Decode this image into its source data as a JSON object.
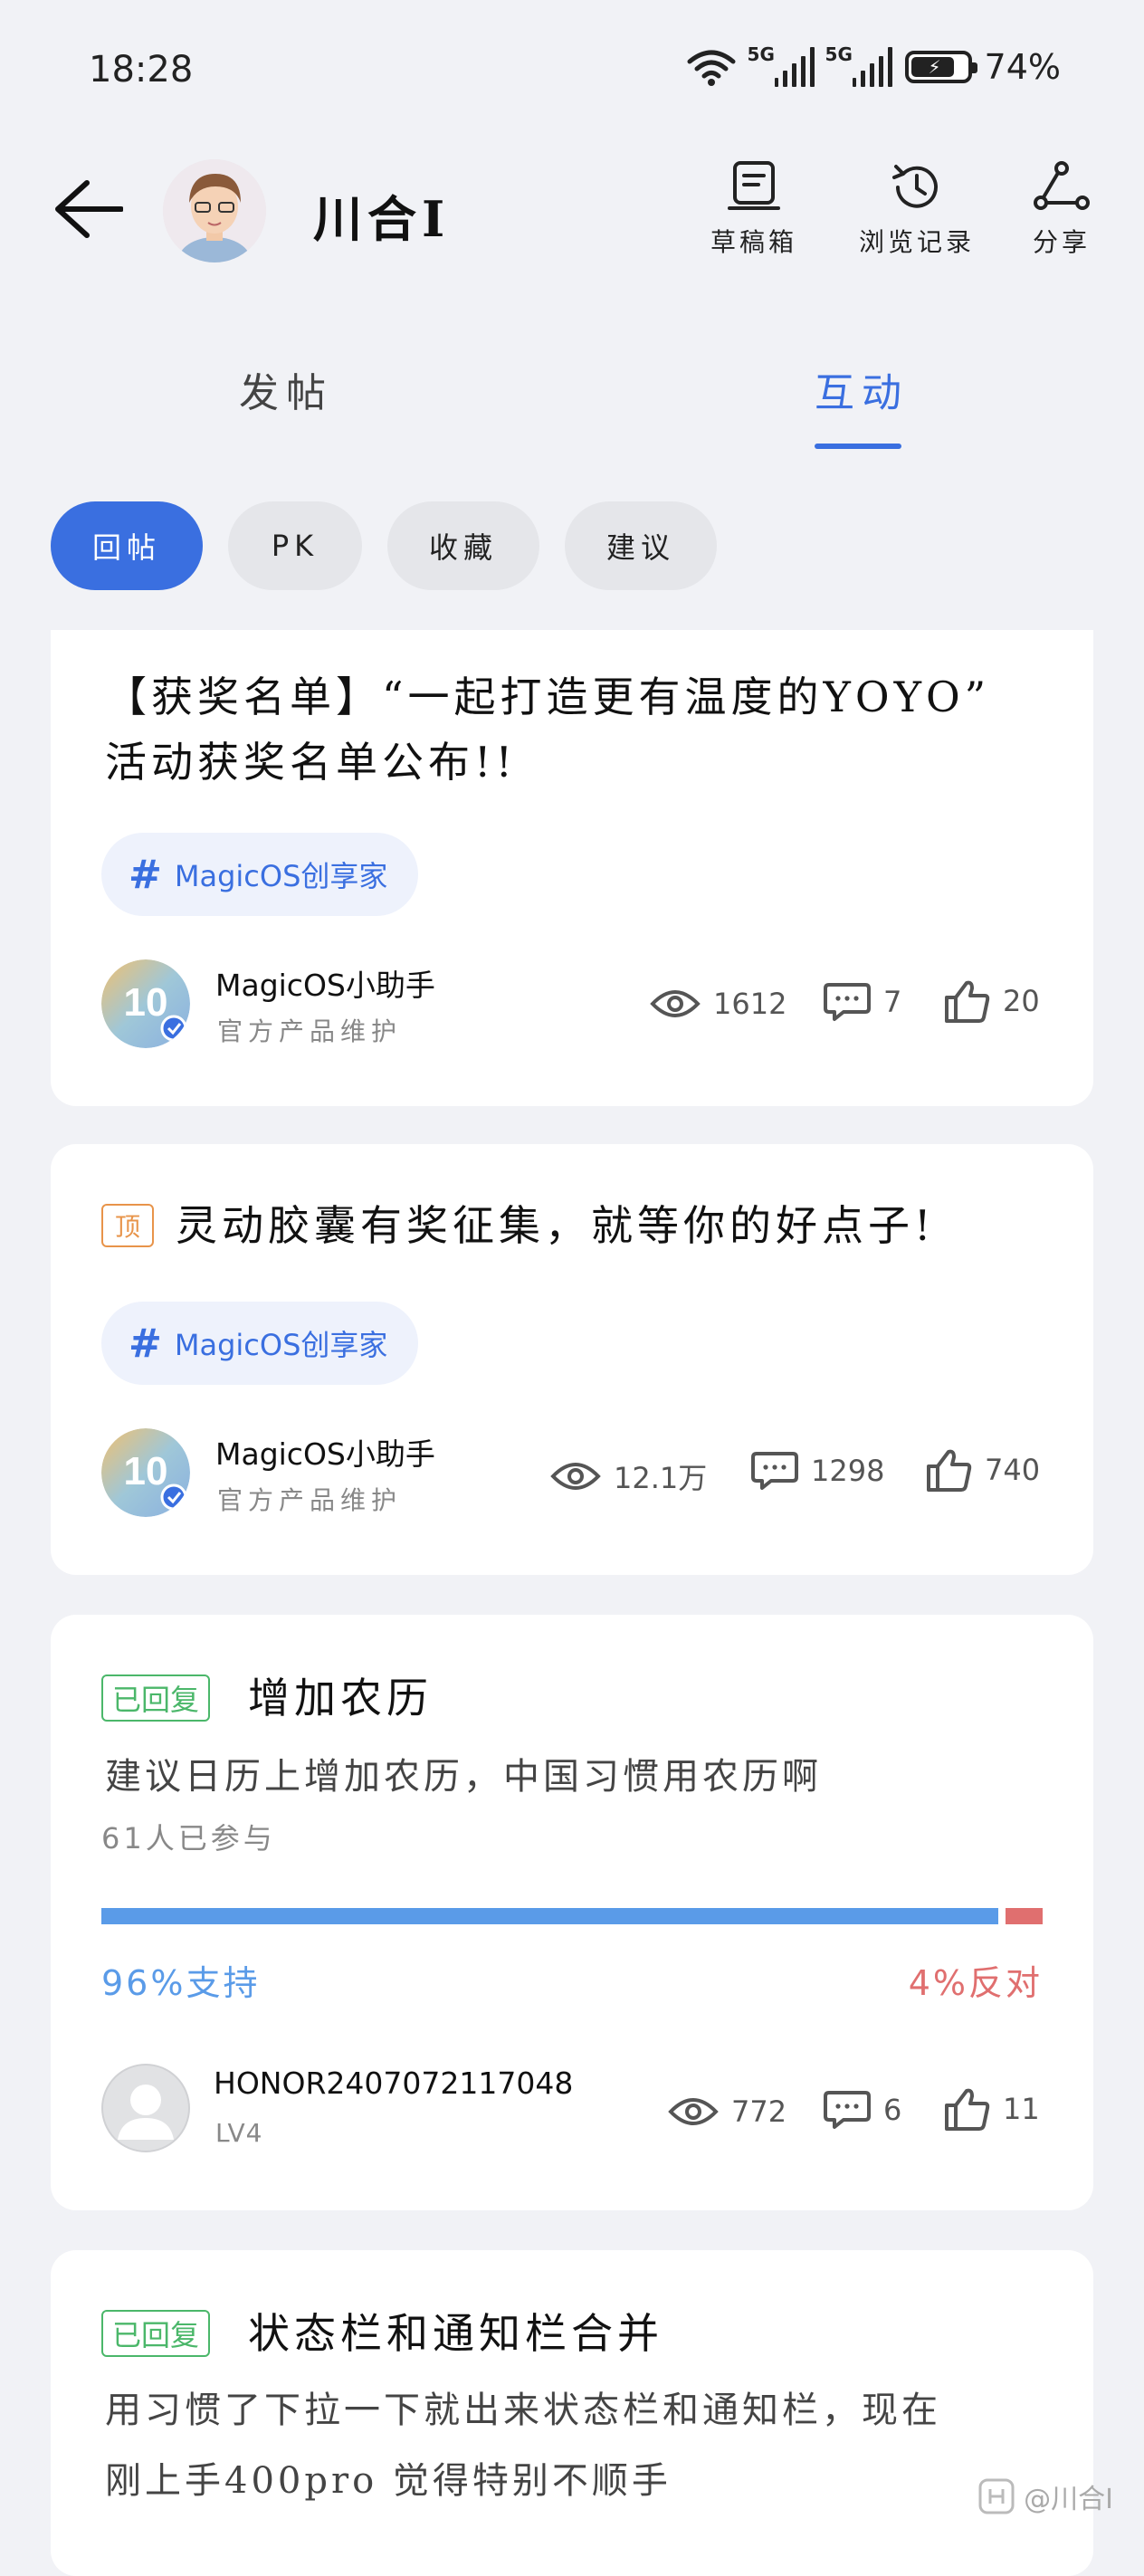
{
  "status_bar": {
    "time": "18:28",
    "network_1": "5G",
    "network_2": "5G",
    "battery": "74%"
  },
  "header": {
    "username": "川合I",
    "actions": [
      {
        "label": "草稿箱",
        "icon": "drafts-icon"
      },
      {
        "label": "浏览记录",
        "icon": "history-icon"
      },
      {
        "label": "分享",
        "icon": "share-icon"
      }
    ]
  },
  "tabs": [
    {
      "label": "发帖",
      "active": false
    },
    {
      "label": "互动",
      "active": true
    }
  ],
  "filters": [
    {
      "label": "回帖",
      "active": true
    },
    {
      "label": "PK",
      "active": false
    },
    {
      "label": "收藏",
      "active": false
    },
    {
      "label": "建议",
      "active": false
    }
  ],
  "posts": [
    {
      "title_line1": "【获奖名单】“一起打造更有温度的YOYO”",
      "title_line2": "活动获奖名单公布!!",
      "topic": "MagicOS创享家",
      "author": "MagicOS小助手",
      "author_sub": "官方产品维护",
      "author_avatar_text": "10",
      "views": "1612",
      "comments": "7",
      "likes": "20"
    },
    {
      "badge": "顶",
      "title": "灵动胶囊有奖征集，就等你的好点子!",
      "topic": "MagicOS创享家",
      "author": "MagicOS小助手",
      "author_sub": "官方产品维护",
      "author_avatar_text": "10",
      "views": "12.1万",
      "comments": "1298",
      "likes": "740"
    },
    {
      "badge": "已回复",
      "title": "增加农历",
      "desc": "建议日历上增加农历，中国习惯用农历啊",
      "participants": "61人已参与",
      "support": "96%支持",
      "oppose": "4%反对",
      "support_pct": 96,
      "author": "HONOR2407072117048",
      "author_sub": "LV4",
      "views": "772",
      "comments": "6",
      "likes": "11"
    },
    {
      "badge": "已回复",
      "title": "状态栏和通知栏合并",
      "desc_line1": "用习惯了下拉一下就出来状态栏和通知栏，现在",
      "desc_line2": "刚上手400pro 觉得特别不顺手"
    }
  ],
  "watermark": "@川合I",
  "colors": {
    "accent": "#3a6fe0",
    "support": "#5a9be8",
    "oppose": "#e06f6f",
    "replied": "#4bb76a",
    "top": "#e8944a"
  }
}
